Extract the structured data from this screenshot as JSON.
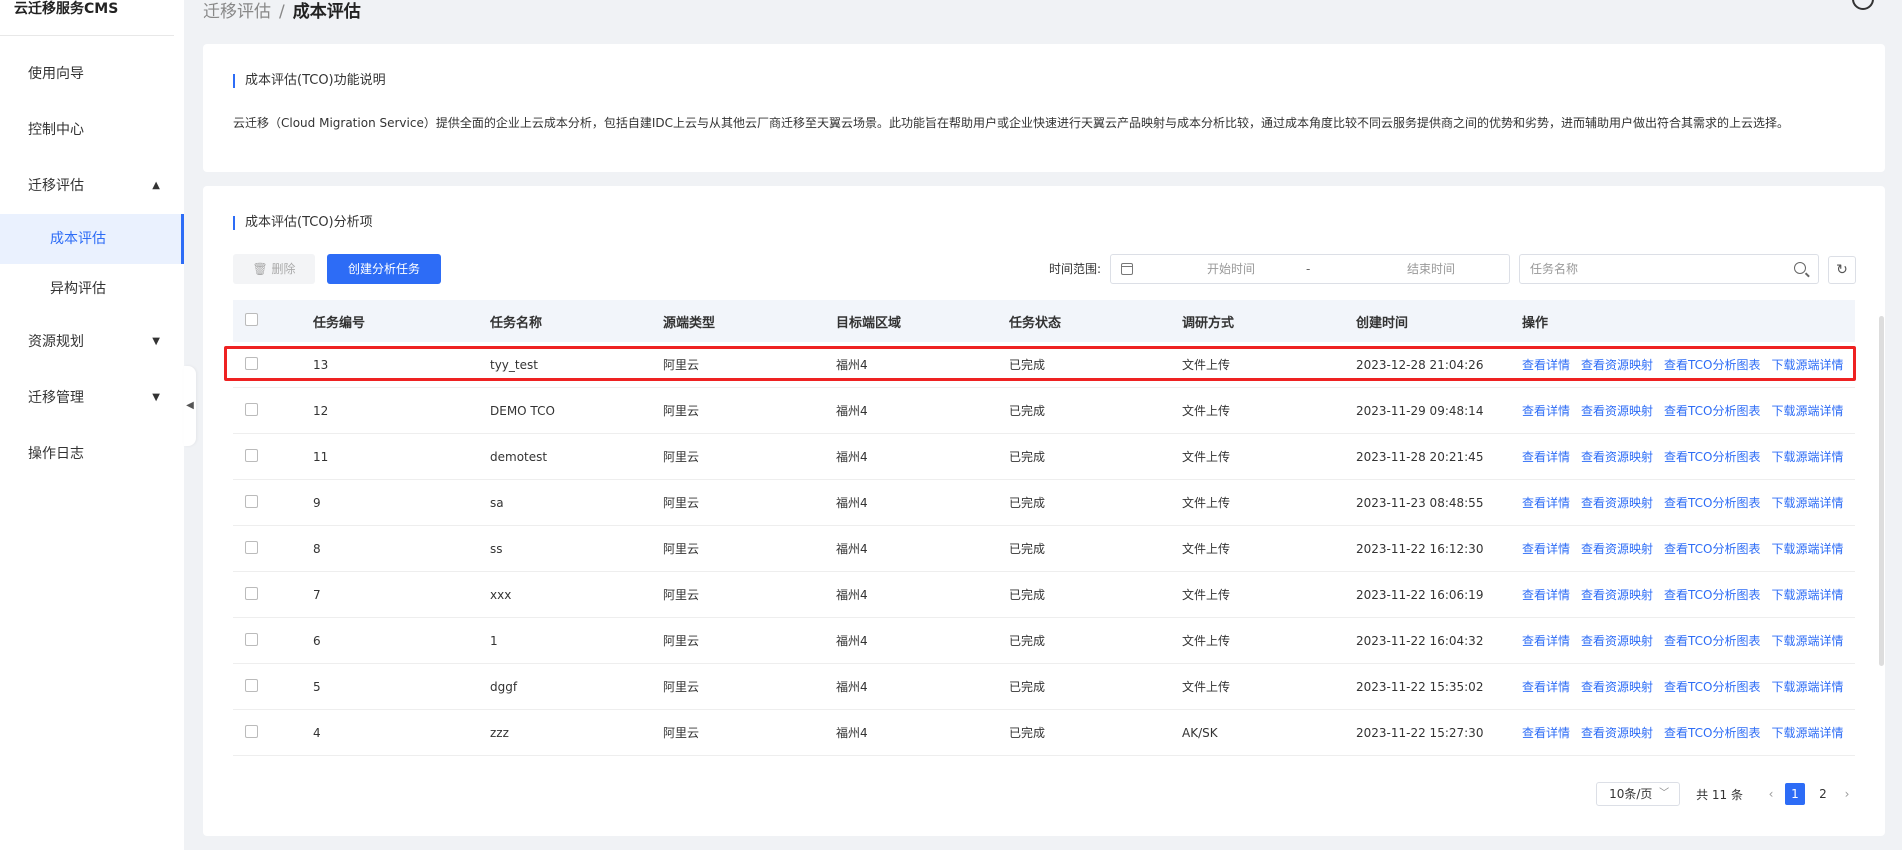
{
  "brand": "云迁移服务CMS",
  "sidebar": {
    "items": [
      {
        "label": "使用向导"
      },
      {
        "label": "控制中心"
      },
      {
        "label": "迁移评估",
        "caret": "▲"
      },
      {
        "label": "成本评估",
        "active": true
      },
      {
        "label": "异构评估"
      },
      {
        "label": "资源规划",
        "caret": "▼"
      },
      {
        "label": "迁移管理",
        "caret": "▼"
      },
      {
        "label": "操作日志"
      }
    ],
    "collapse": "◀"
  },
  "breadcrumb": {
    "parent": "迁移评估",
    "sep": "/",
    "current": "成本评估"
  },
  "intro": {
    "title": "成本评估(TCO)功能说明",
    "text": "云迁移（Cloud Migration Service）提供全面的企业上云成本分析，包括自建IDC上云与从其他云厂商迁移至天翼云场景。此功能旨在帮助用户或企业快速进行天翼云产品映射与成本分析比较，通过成本角度比较不同云服务提供商之间的优势和劣势，进而辅助用户做出符合其需求的上云选择。"
  },
  "analysis": {
    "title": "成本评估(TCO)分析项",
    "delete_label": "删除",
    "delete_icon": "trash-icon",
    "create_label": "创建分析任务",
    "time_label": "时间范围:",
    "start_placeholder": "开始时间",
    "range_sep": "-",
    "end_placeholder": "结束时间",
    "search_placeholder": "任务名称",
    "refresh_icon": "↻"
  },
  "table": {
    "headers": [
      "任务编号",
      "任务名称",
      "源端类型",
      "目标端区域",
      "任务状态",
      "调研方式",
      "创建时间",
      "操作"
    ],
    "actions": [
      "查看详情",
      "查看资源映射",
      "查看TCO分析图表",
      "下载源端详情"
    ],
    "rows": [
      {
        "id": "13",
        "name": "tyy_test",
        "source": "阿里云",
        "region": "福州4",
        "status": "已完成",
        "method": "文件上传",
        "created": "2023-12-28 21:04:26"
      },
      {
        "id": "12",
        "name": "DEMO TCO",
        "source": "阿里云",
        "region": "福州4",
        "status": "已完成",
        "method": "文件上传",
        "created": "2023-11-29 09:48:14"
      },
      {
        "id": "11",
        "name": "demotest",
        "source": "阿里云",
        "region": "福州4",
        "status": "已完成",
        "method": "文件上传",
        "created": "2023-11-28 20:21:45"
      },
      {
        "id": "9",
        "name": "sa",
        "source": "阿里云",
        "region": "福州4",
        "status": "已完成",
        "method": "文件上传",
        "created": "2023-11-23 08:48:55"
      },
      {
        "id": "8",
        "name": "ss",
        "source": "阿里云",
        "region": "福州4",
        "status": "已完成",
        "method": "文件上传",
        "created": "2023-11-22 16:12:30"
      },
      {
        "id": "7",
        "name": "xxx",
        "source": "阿里云",
        "region": "福州4",
        "status": "已完成",
        "method": "文件上传",
        "created": "2023-11-22 16:06:19"
      },
      {
        "id": "6",
        "name": "1",
        "source": "阿里云",
        "region": "福州4",
        "status": "已完成",
        "method": "文件上传",
        "created": "2023-11-22 16:04:32"
      },
      {
        "id": "5",
        "name": "dggf",
        "source": "阿里云",
        "region": "福州4",
        "status": "已完成",
        "method": "文件上传",
        "created": "2023-11-22 15:35:02"
      },
      {
        "id": "4",
        "name": "zzz",
        "source": "阿里云",
        "region": "福州4",
        "status": "已完成",
        "method": "AK/SK",
        "created": "2023-11-22 15:27:30"
      }
    ]
  },
  "pagination": {
    "page_size": "10条/页",
    "total": "共 11 条",
    "prev": "‹",
    "next": "›",
    "pages": [
      "1",
      "2"
    ],
    "current": "1"
  },
  "colors": {
    "accent": "#2d6cf6",
    "highlight": "#e22222"
  }
}
